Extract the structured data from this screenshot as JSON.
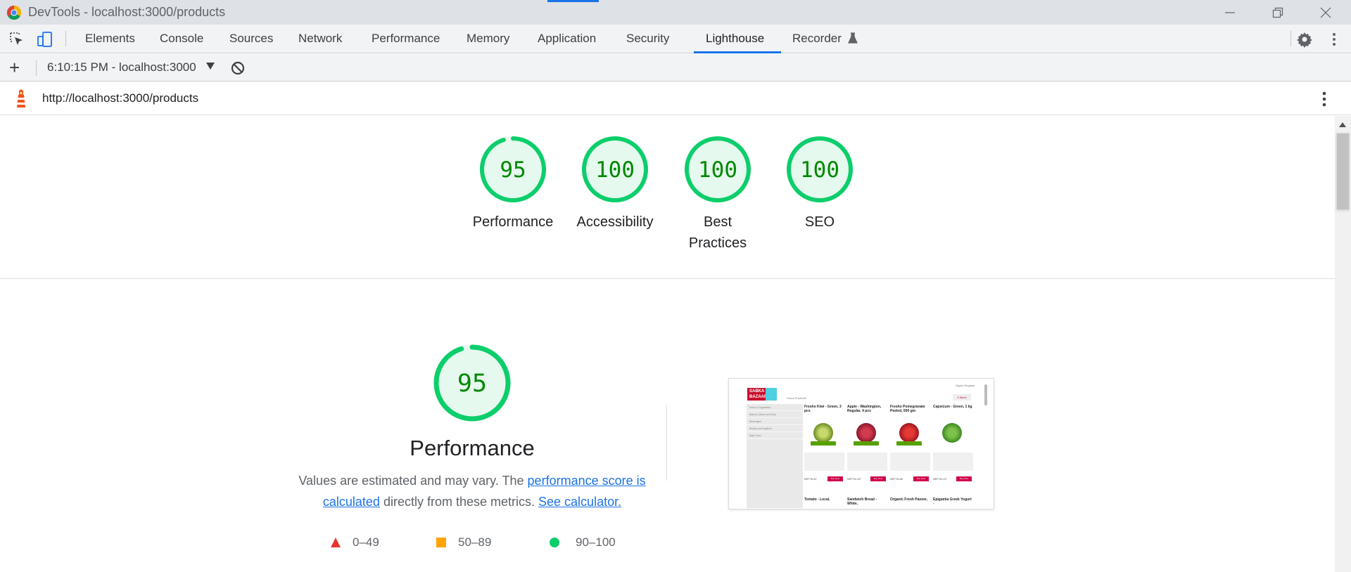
{
  "window": {
    "title": "DevTools - localhost:3000/products"
  },
  "devtools_tabs": [
    {
      "label": "Elements"
    },
    {
      "label": "Console"
    },
    {
      "label": "Sources"
    },
    {
      "label": "Network"
    },
    {
      "label": "Performance"
    },
    {
      "label": "Memory"
    },
    {
      "label": "Application"
    },
    {
      "label": "Security"
    },
    {
      "label": "Lighthouse",
      "active": true
    },
    {
      "label": "Recorder"
    }
  ],
  "lighthouse_toolbar": {
    "report_label": "6:10:15 PM - localhost:3000"
  },
  "url_bar": {
    "url": "http://localhost:3000/products"
  },
  "categories": [
    {
      "score": "95",
      "label": "Performance",
      "value": 95
    },
    {
      "score": "100",
      "label": "Accessibility",
      "value": 100
    },
    {
      "score": "100",
      "label": "Best Practices",
      "label_line1": "Best",
      "label_line2": "Practices",
      "value": 100
    },
    {
      "score": "100",
      "label": "SEO",
      "value": 100
    }
  ],
  "performance_section": {
    "score": "95",
    "value": 95,
    "title": "Performance",
    "desc_prefix": "Values are estimated and may vary. The ",
    "desc_link1": "performance score is calculated",
    "desc_middle": " directly from these metrics. ",
    "desc_link2": "See calculator.",
    "legend": [
      {
        "range": "0–49",
        "shape": "triangle",
        "color": "#e8352e"
      },
      {
        "range": "50–89",
        "shape": "square",
        "color": "#ffa400"
      },
      {
        "range": "90–100",
        "shape": "circle",
        "color": "#0cce6b"
      }
    ]
  },
  "screenshot": {
    "logo": "SABKA BAZAAR",
    "nav": "Home   Products",
    "signin": "SignIn   Register",
    "cart": "0 items",
    "sidebar_items": [
      "Fruits & Vegetables",
      "Bakery Cakes and Dairy",
      "Beverages",
      "Beauty and Hygiene",
      "Baby Care"
    ],
    "products": [
      {
        "name": "Fresho Kiwi - Green, 3 pcs",
        "price": "MRP Rs.87",
        "buy": "Buy Now",
        "color": "#6b8e23"
      },
      {
        "name": "Apple - Washington, Regular, 4 pcs",
        "price": "MRP Rs.187",
        "buy": "Buy Now",
        "color": "#a01830"
      },
      {
        "name": "Fresho Pomegranate Peeled, 500 gm",
        "price": "MRP Rs.88",
        "buy": "Buy Now",
        "color": "#b2182b"
      },
      {
        "name": "Capsicum - Green, 1 kg",
        "price": "MRP Rs.137",
        "buy": "Buy Now",
        "color": "#3a9a1f"
      }
    ],
    "row2": [
      "Tomato - Local,",
      "Sandwich Bread - White,",
      "Organic Fresh Paneer,",
      "Epigamia Greek Yogurt -"
    ]
  },
  "colors": {
    "pass": "#0cce6b",
    "pass_text": "#008800",
    "pass_bg": "#e5f9ee",
    "accent": "#1a73e8",
    "lighthouse_orange": "#f4511e"
  }
}
